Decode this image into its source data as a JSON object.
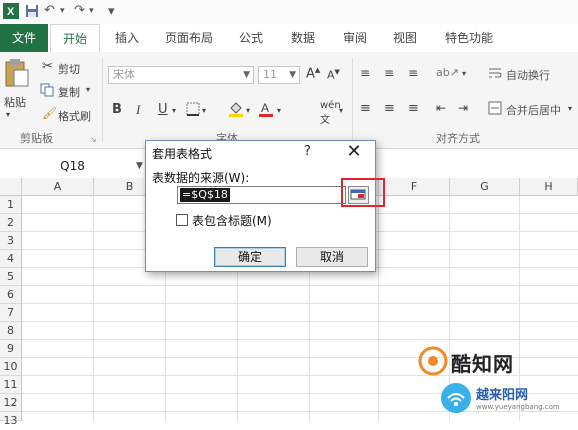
{
  "quick_access": {
    "save_icon": "save-icon",
    "undo_icon": "undo-icon",
    "redo_icon": "redo-icon",
    "customize": "▾"
  },
  "tabs": [
    "文件",
    "开始",
    "插入",
    "页面布局",
    "公式",
    "数据",
    "审阅",
    "视图",
    "特色功能"
  ],
  "ribbon": {
    "clipboard": {
      "paste": "粘贴",
      "cut": "剪切",
      "copy": "复制",
      "format_painter": "格式刷",
      "group_label": "剪贴板"
    },
    "font": {
      "font_name": "宋体",
      "font_size": "11",
      "bold": "B",
      "italic": "I",
      "underline": "U",
      "group_label": "字体"
    },
    "alignment": {
      "wrap_text": "自动换行",
      "merge_center": "合并后居中",
      "group_label": "对齐方式"
    }
  },
  "name_box": "Q18",
  "columns": [
    "A",
    "B",
    "C",
    "D",
    "E",
    "F",
    "G",
    "H"
  ],
  "rows": [
    "1",
    "2",
    "3",
    "4",
    "5",
    "6",
    "7",
    "8",
    "9",
    "10",
    "11",
    "12",
    "13"
  ],
  "dialog": {
    "title": "套用表格式",
    "help": "?",
    "close": "✕",
    "source_label": "表数据的来源(W):",
    "source_value": "=$Q$18",
    "has_headers_label": "表包含标题(M)",
    "has_headers_checked": false,
    "ok": "确定",
    "cancel": "取消"
  },
  "watermark": {
    "line1": "酷知网",
    "line2": "越来阳网",
    "url": "www.yueyangbang.com"
  },
  "colors": {
    "file_tab": "#217346",
    "highlight": "#e0262d",
    "dialog_border": "#6d8fc0"
  }
}
